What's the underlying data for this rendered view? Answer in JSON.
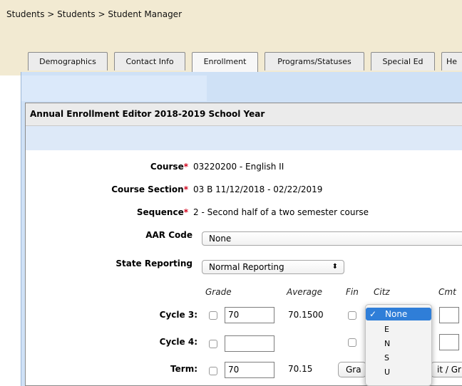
{
  "breadcrumb": "Students > Students > Student Manager",
  "tabs": [
    {
      "label": "Demographics",
      "active": false
    },
    {
      "label": "Contact Info",
      "active": false
    },
    {
      "label": "Enrollment",
      "active": true
    },
    {
      "label": "Programs/Statuses",
      "active": false
    },
    {
      "label": "Special Ed",
      "active": false
    },
    {
      "label": "He",
      "active": false
    }
  ],
  "panel": {
    "title": "Annual Enrollment Editor 2018-2019 School Year"
  },
  "fields": {
    "course_label": "Course",
    "course_value": "03220200 - English II",
    "section_label": "Course Section",
    "section_value": "03 B 11/12/2018 - 02/22/2019",
    "sequence_label": "Sequence",
    "sequence_value": "2 - Second half of a two semester course",
    "required_mark": "*",
    "aar_label": "AAR Code",
    "aar_value": "None",
    "state_label": "State Reporting",
    "state_value": "Normal Reporting",
    "state_arrows": "⬍"
  },
  "grid": {
    "headers": {
      "grade": "Grade",
      "average": "Average",
      "fin": "Fin",
      "citz": "Citz",
      "cmt": "Cmt"
    },
    "rows": [
      {
        "label": "Cycle 3:",
        "grade": "70",
        "average": "70.1500"
      },
      {
        "label": "Cycle 4:",
        "grade": "",
        "average": ""
      },
      {
        "label": "Term:",
        "grade": "70",
        "average": "70.15"
      }
    ],
    "term_button1": "Gra",
    "term_button2": "it / Gr"
  },
  "citz_dropdown": {
    "check": "✓",
    "options": [
      "None",
      "E",
      "N",
      "S",
      "U"
    ],
    "selected": "None"
  },
  "colors": {
    "breadcrumb_bg": "#f2ead2",
    "frame_blue": "#cfe1f6",
    "required": "#d0021b",
    "selected_option": "#2f7ed8"
  }
}
